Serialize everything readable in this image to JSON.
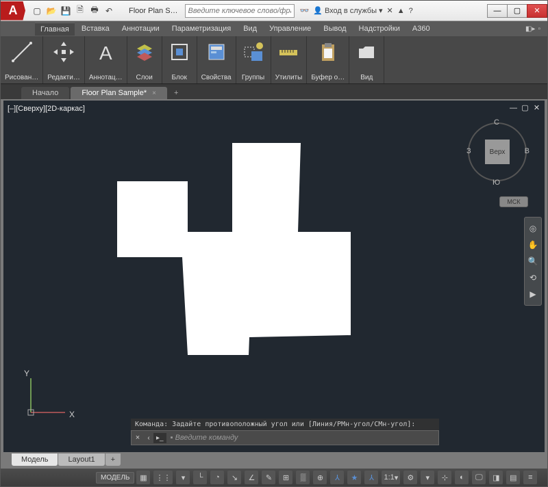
{
  "titlebar": {
    "logo_text": "A",
    "qat_icons": [
      "folder-icon",
      "open-icon",
      "save-icon",
      "saveas-icon",
      "print-icon",
      "undo-icon"
    ],
    "title": "Floor Plan S…",
    "search_placeholder": "Введите ключевое слово/фразу",
    "signin_label": "Вход в службы",
    "help_char": "?"
  },
  "menu": {
    "tabs": [
      "Главная",
      "Вставка",
      "Аннотации",
      "Параметризация",
      "Вид",
      "Управление",
      "Вывод",
      "Надстройки",
      "A360"
    ],
    "active": 0
  },
  "ribbon": {
    "panels": [
      {
        "label": "Рисован…"
      },
      {
        "label": "Редакти…"
      },
      {
        "label": "Аннотац…"
      },
      {
        "label": "Слои"
      },
      {
        "label": "Блок"
      },
      {
        "label": "Свойства"
      },
      {
        "label": "Группы"
      },
      {
        "label": "Утилиты"
      },
      {
        "label": "Буфер о…"
      },
      {
        "label": "Вид"
      }
    ]
  },
  "doctabs": {
    "inactive": "Начало",
    "active": "Floor Plan Sample*"
  },
  "viewport": {
    "label": "[–][Сверху][2D-каркас]"
  },
  "viewcube": {
    "top": "С",
    "right": "В",
    "bottom": "Ю",
    "left": "З",
    "face": "Верх"
  },
  "wcs_button": "МСК",
  "ucs": {
    "x": "X",
    "y": "Y"
  },
  "cmd": {
    "history": "Команда: Задайте противоположный угол или [Линия/РМн-угол/СМн-угол]:",
    "placeholder": "Введите команду"
  },
  "layouts": {
    "active": "Модель",
    "inactive": "Layout1"
  },
  "status": {
    "model": "МОДЕЛЬ",
    "scale": "1:1"
  }
}
